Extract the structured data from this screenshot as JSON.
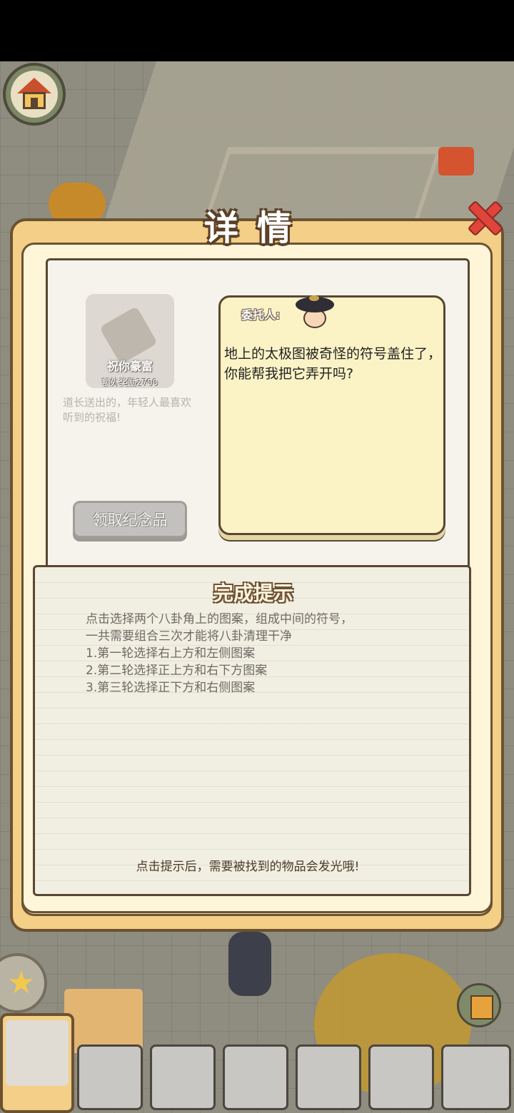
{
  "modal": {
    "title": "详情"
  },
  "reward": {
    "name": "祝你豪富",
    "bonus": "额外奖励2700",
    "description": "道长送出的，年轻人最喜欢听到的祝福!",
    "claim_label": "领取纪念品"
  },
  "quest": {
    "client_label": "委托人:",
    "text": "地上的太极图被奇怪的符号盖住了，你能帮我把它弄开吗?"
  },
  "hint": {
    "title": "完成提示",
    "lines": [
      "点击选择两个八卦角上的图案，组成中间的符号，",
      "一共需要组合三次才能将八卦清理干净",
      "1.第一轮选择右上方和左侧图案",
      "2.第二轮选择正上方和右下方图案",
      "3.第三轮选择正下方和右侧图案"
    ],
    "footer": "点击提示后，需要被找到的物品会发光哦!"
  },
  "icons": {
    "home": "home-icon",
    "close": "close-icon",
    "star": "star-icon",
    "book": "book-icon"
  },
  "colors": {
    "modal_frame": "#f3cf87",
    "close_red": "#e0443a",
    "paper": "#f5f3ec",
    "quest_box": "#fbf3c6"
  }
}
